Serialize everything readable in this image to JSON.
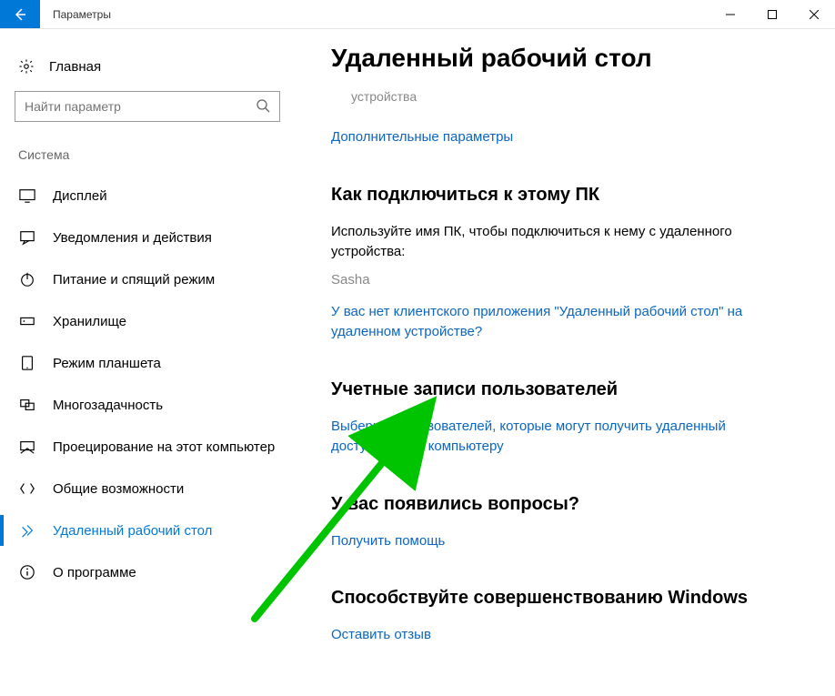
{
  "window": {
    "title": "Параметры"
  },
  "sidebar": {
    "home_label": "Главная",
    "search_placeholder": "Найти параметр",
    "group_label": "Система",
    "items": [
      {
        "label": "Дисплей"
      },
      {
        "label": "Уведомления и действия"
      },
      {
        "label": "Питание и спящий режим"
      },
      {
        "label": "Хранилище"
      },
      {
        "label": "Режим планшета"
      },
      {
        "label": "Многозадачность"
      },
      {
        "label": "Проецирование на этот компьютер"
      },
      {
        "label": "Общие возможности"
      },
      {
        "label": "Удаленный рабочий стол"
      },
      {
        "label": "О программе"
      }
    ]
  },
  "main": {
    "page_title": "Удаленный рабочий стол",
    "device_sub": "устройства",
    "advanced_link": "Дополнительные параметры",
    "connect_h": "Как подключиться к этому ПК",
    "connect_para": "Используйте имя ПК, чтобы подключиться к нему с удаленного устройства:",
    "pc_name": "Sasha",
    "noclient_link": "У вас нет клиентского приложения \"Удаленный рабочий стол\" на удаленном устройстве?",
    "users_h": "Учетные записи пользователей",
    "users_link": "Выберите пользователей, которые могут получить удаленный доступ к этому компьютеру",
    "faq_h": "У вас появились вопросы?",
    "help_link": "Получить помощь",
    "improve_h": "Способствуйте совершенствованию Windows",
    "feedback_link": "Оставить отзыв"
  }
}
